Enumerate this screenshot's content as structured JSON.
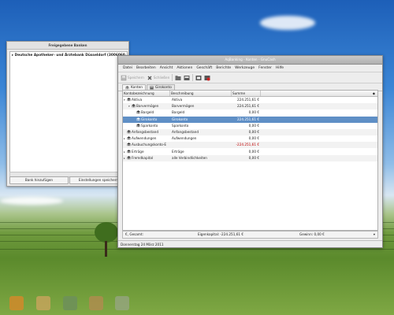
{
  "left_window": {
    "title": "Freigegebene Banken",
    "bank": "Deutsche Apotheker- und Ärztebank Düsseldorf (3006060",
    "add_bank_button": "Bank hinzufügen",
    "settings_button": "Einstellungen speichern"
  },
  "main_window": {
    "title": "AqBanking - Konten - GnuCash",
    "menu": [
      "Datei",
      "Bearbeiten",
      "Ansicht",
      "Aktionen",
      "Geschäft",
      "Berichte",
      "Werkzeuge",
      "Fenster",
      "Hilfe"
    ],
    "toolbar": {
      "open_label": "Speichern",
      "delete_label": "Schließen"
    },
    "tabs": [
      "Konten",
      "Girokonto"
    ],
    "columns": [
      "Kontobezeichnung",
      "Beschreibung",
      "Summe"
    ],
    "rows": [
      {
        "name": "Aktiva",
        "desc": "Aktiva",
        "sum": "224.251,61 €",
        "indent": 0,
        "expander": "▾",
        "style": ""
      },
      {
        "name": "Barvermögen",
        "desc": "Barvermögen",
        "sum": "224.251,61 €",
        "indent": 1,
        "expander": "▾",
        "style": "alt"
      },
      {
        "name": "Bargeld",
        "desc": "Bargeld",
        "sum": "0,00 €",
        "indent": 2,
        "expander": "",
        "style": ""
      },
      {
        "name": "Girokonto",
        "desc": "Girokonto",
        "sum": "224.251,61 €",
        "indent": 2,
        "expander": "",
        "style": "sel"
      },
      {
        "name": "Sparkonto",
        "desc": "Sparkonto",
        "sum": "0,00 €",
        "indent": 2,
        "expander": "",
        "style": ""
      },
      {
        "name": "Anfangsbestand",
        "desc": "Anfangsbestand",
        "sum": "0,00 €",
        "indent": 0,
        "expander": "",
        "style": "alt"
      },
      {
        "name": "Aufwendungen",
        "desc": "Aufwendungen",
        "sum": "0,00 €",
        "indent": 0,
        "expander": "▸",
        "style": ""
      },
      {
        "name": "Ausbuchungskonto-E",
        "desc": "",
        "sum": "-224.251,61 €",
        "indent": 0,
        "expander": "",
        "style": "alt",
        "negative": true
      },
      {
        "name": "Erträge",
        "desc": "Erträge",
        "sum": "0,00 €",
        "indent": 0,
        "expander": "▸",
        "style": ""
      },
      {
        "name": "Fremdkapital",
        "desc": "alle Verbindlichkeiten",
        "sum": "0,00 €",
        "indent": 0,
        "expander": "▸",
        "style": "alt"
      }
    ],
    "summary": {
      "currency": "€, Gesamt:",
      "equity": "Eigenkapital: -224.251,61 €",
      "profit": "Gewinn: 0,00 €"
    },
    "status": "Donnerstag 24 März 2011"
  },
  "colors": {
    "selection": "#5f8fc6",
    "negative": "#c00000"
  }
}
